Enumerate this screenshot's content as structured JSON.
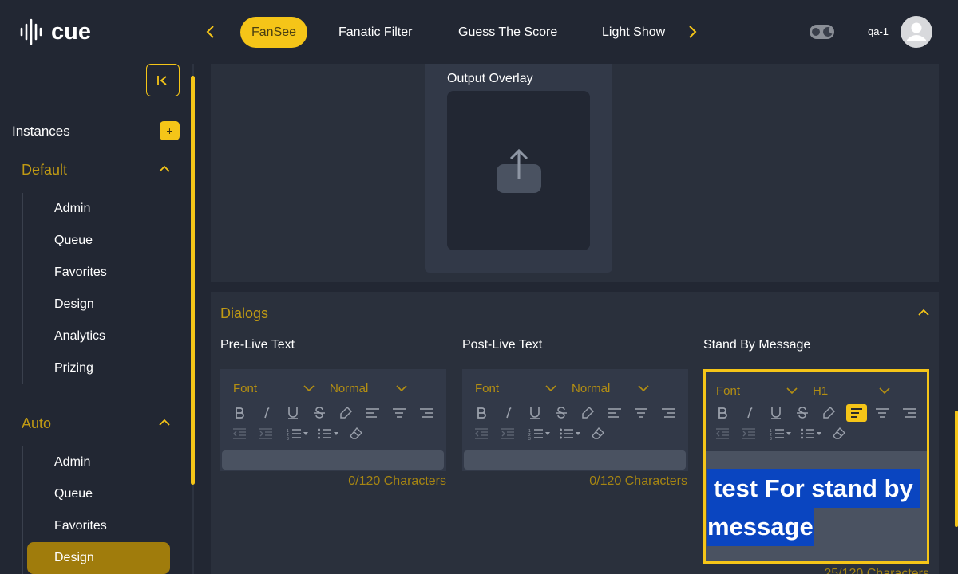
{
  "header": {
    "logo_text": "cue",
    "tabs": [
      {
        "label": "FanSee",
        "active": true
      },
      {
        "label": "Fanatic Filter",
        "active": false
      },
      {
        "label": "Guess The Score",
        "active": false
      },
      {
        "label": "Light Show",
        "active": false
      }
    ],
    "username": "qa-1"
  },
  "sidebar": {
    "instances_label": "Instances",
    "add_label": "+",
    "groups": [
      {
        "title": "Default",
        "items": [
          "Admin",
          "Queue",
          "Favorites",
          "Design",
          "Analytics",
          "Prizing"
        ]
      },
      {
        "title": "Auto",
        "items": [
          "Admin",
          "Queue",
          "Favorites",
          "Design"
        ],
        "active_item": "Design"
      }
    ]
  },
  "overlay": {
    "label": "Output Overlay"
  },
  "dialogs": {
    "title": "Dialogs",
    "editors": [
      {
        "label": "Pre-Live Text",
        "font": "Font",
        "size": "Normal",
        "content": "",
        "count": "0/120 Characters"
      },
      {
        "label": "Post-Live Text",
        "font": "Font",
        "size": "Normal",
        "content": "",
        "count": "0/120 Characters"
      },
      {
        "label": "Stand By Message",
        "font": "Font",
        "size": "H1",
        "content_line1": "test For stand by",
        "content_line2": "message",
        "count": "25/120 Characters"
      }
    ]
  },
  "colors": {
    "accent": "#f5c518",
    "accent_dark": "#a07c0c",
    "background": "#222733",
    "panel": "#2a303c",
    "selection": "#0a45c0"
  }
}
